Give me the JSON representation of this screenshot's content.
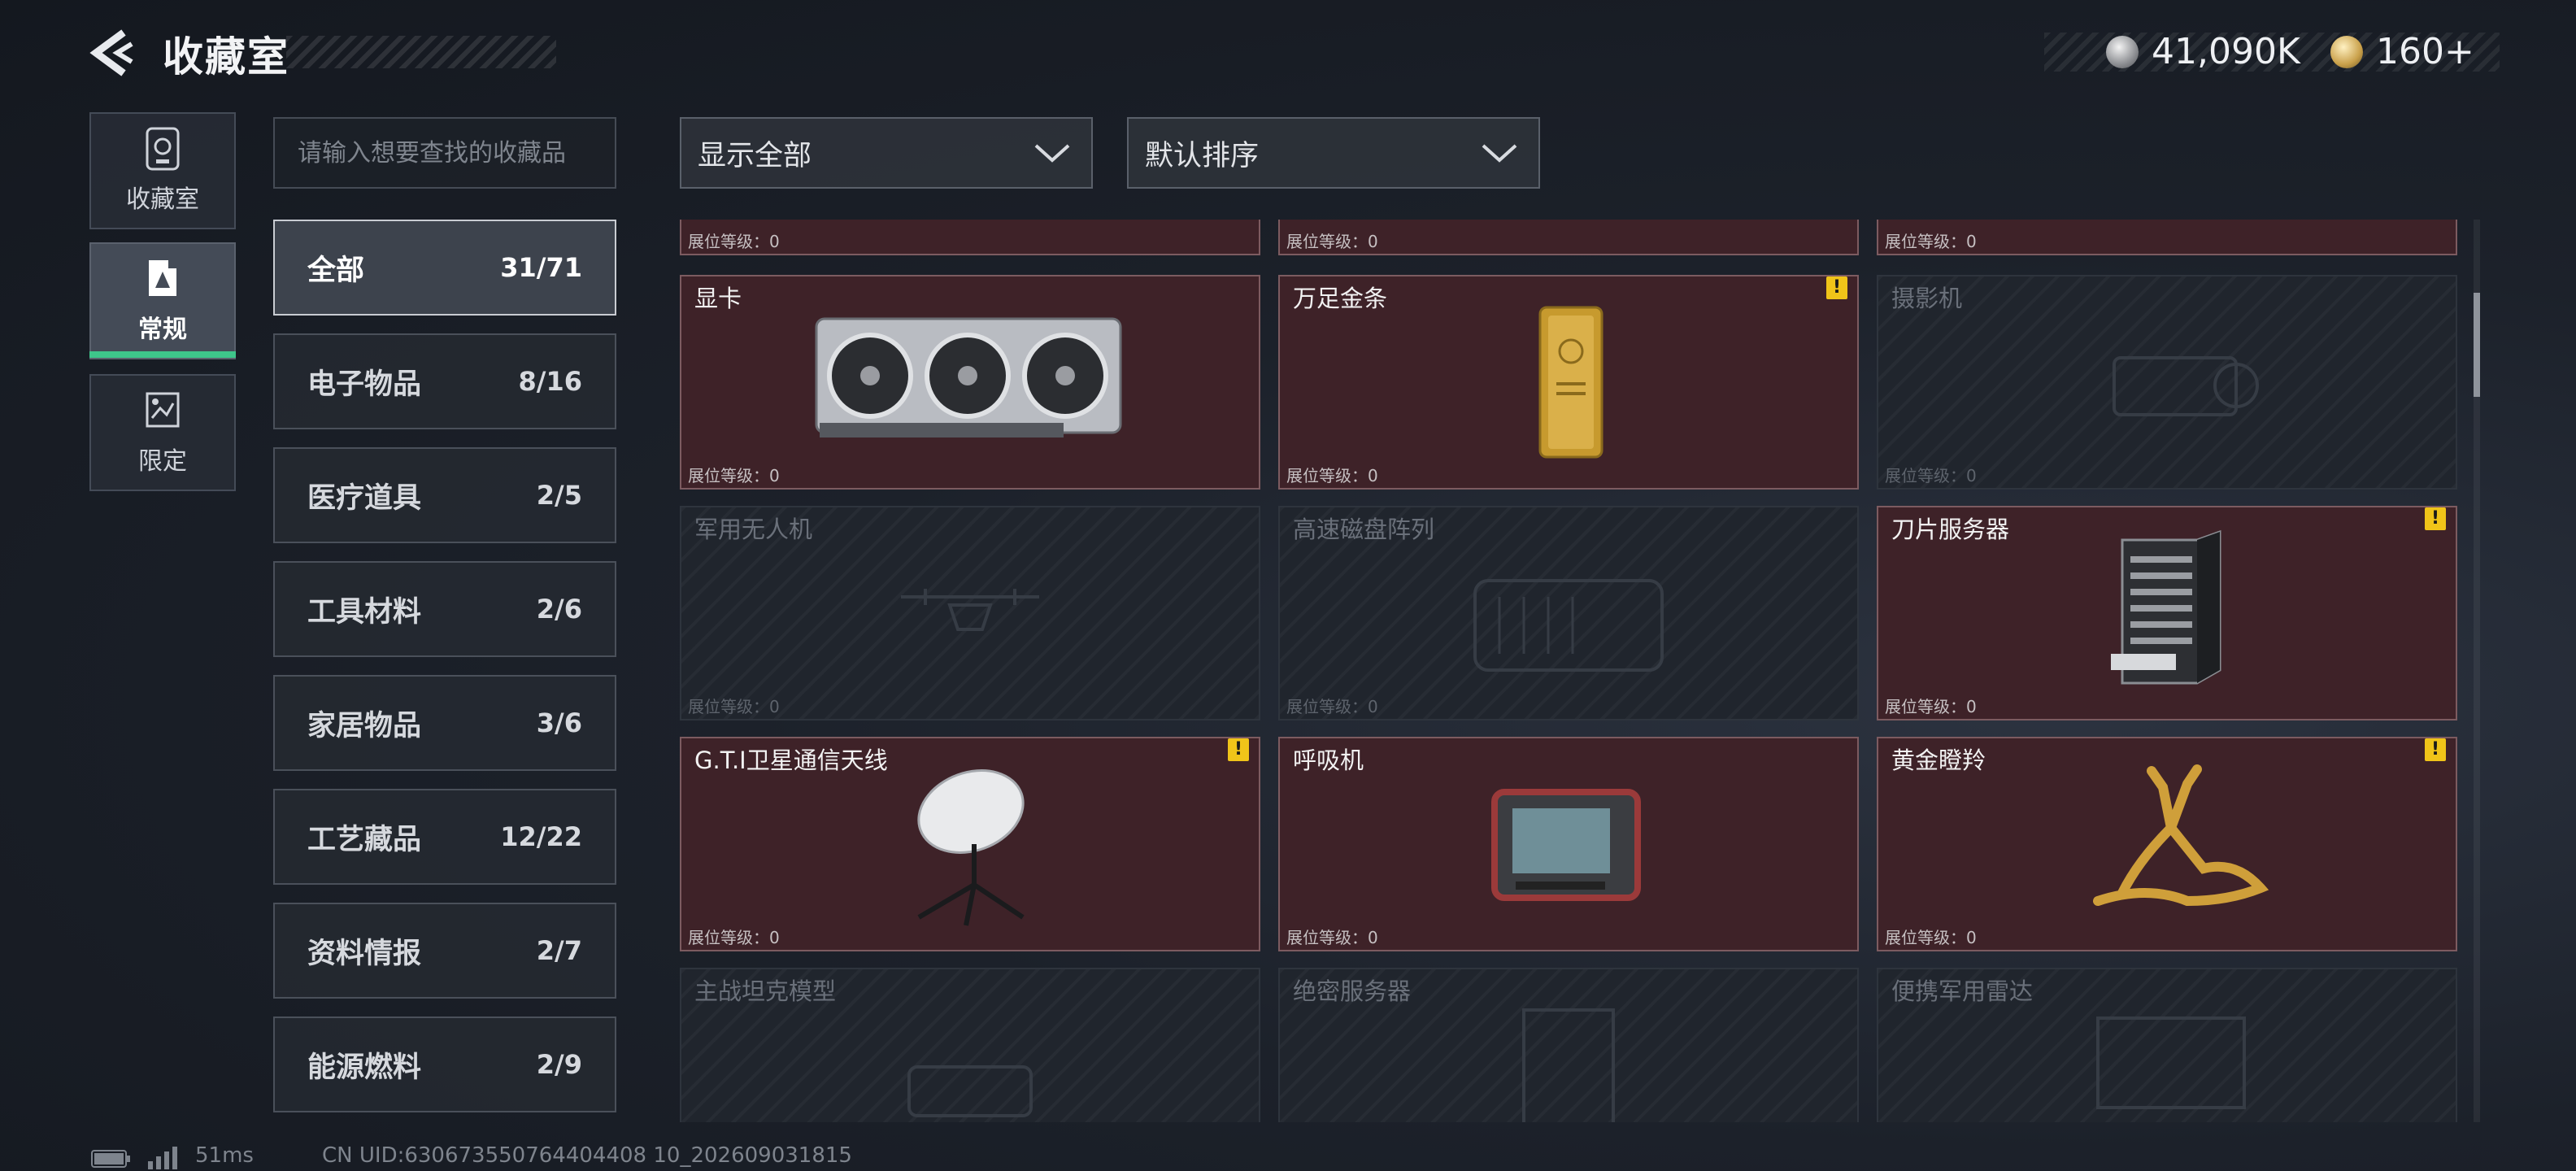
{
  "header": {
    "title": "收藏室"
  },
  "currency": {
    "silver": "41,090K",
    "gold": "160+"
  },
  "side_tabs": [
    {
      "label": "收藏室"
    },
    {
      "label": "常规"
    },
    {
      "label": "限定"
    }
  ],
  "search": {
    "placeholder": "请输入想要查找的收藏品"
  },
  "categories": [
    {
      "name": "全部",
      "count": "31/71"
    },
    {
      "name": "电子物品",
      "count": "8/16"
    },
    {
      "name": "医疗道具",
      "count": "2/5"
    },
    {
      "name": "工具材料",
      "count": "2/6"
    },
    {
      "name": "家居物品",
      "count": "3/6"
    },
    {
      "name": "工艺藏品",
      "count": "12/22"
    },
    {
      "name": "资料情报",
      "count": "2/7"
    },
    {
      "name": "能源燃料",
      "count": "2/9"
    }
  ],
  "filters": {
    "show": "显示全部",
    "sort": "默认排序"
  },
  "level_label": "展位等级：0",
  "items": [
    {
      "name": "",
      "level": "展位等级：0"
    },
    {
      "name": "",
      "level": "展位等级：0"
    },
    {
      "name": "",
      "level": "展位等级：0"
    },
    {
      "name": "显卡",
      "level": "展位等级：0"
    },
    {
      "name": "万足金条",
      "level": "展位等级：0"
    },
    {
      "name": "摄影机",
      "level": "展位等级：0"
    },
    {
      "name": "军用无人机",
      "level": "展位等级：0"
    },
    {
      "name": "高速磁盘阵列",
      "level": "展位等级：0"
    },
    {
      "name": "刀片服务器",
      "level": "展位等级：0"
    },
    {
      "name": "G.T.I卫星通信天线",
      "level": "展位等级：0"
    },
    {
      "name": "呼吸机",
      "level": "展位等级：0"
    },
    {
      "name": "黄金瞪羚",
      "level": "展位等级：0"
    },
    {
      "name": "主战坦克模型",
      "level": ""
    },
    {
      "name": "绝密服务器",
      "level": ""
    },
    {
      "name": "便携军用雷达",
      "level": ""
    }
  ],
  "status": {
    "ping": "51ms",
    "uid": "CN UID:630673550764404408 10_202609031815"
  },
  "colors": {
    "accent_green": "#3ec58a",
    "owned_card": "#3e2228",
    "warning": "#f0c419"
  }
}
